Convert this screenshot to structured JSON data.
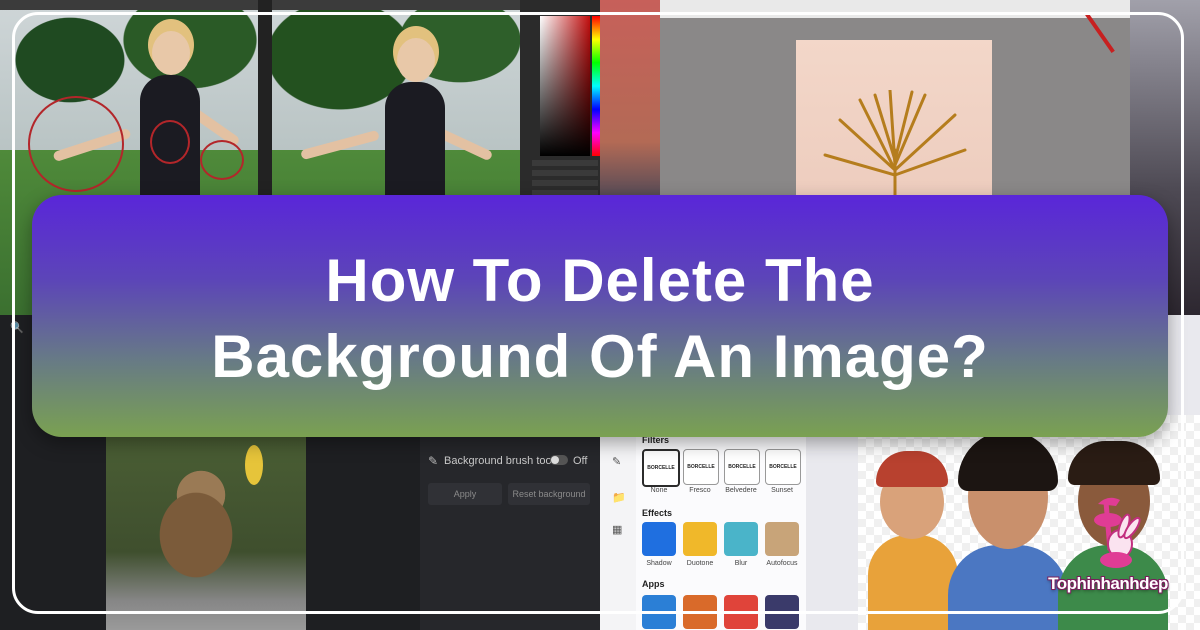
{
  "headline": {
    "line1": "How To Delete The",
    "line2": "Background Of An Image?"
  },
  "collage": {
    "bottom_left_app": {
      "toggle_label": "Background brush tool",
      "toggle_state": "Off",
      "apply_label": "Apply",
      "reset_label": "Reset background"
    },
    "bottom_right_app": {
      "filters_title": "Filters",
      "filters": [
        "None",
        "Fresco",
        "Belvedere",
        "Sunset"
      ],
      "filter_badge_text": "BORCELLE",
      "effects_title": "Effects",
      "effects": [
        "Shadow",
        "Duotone",
        "Blur",
        "Autofocus"
      ],
      "apps_title": "Apps"
    }
  },
  "logo": {
    "text": "Tophinhanhdep"
  },
  "colors": {
    "banner_top": "#5a26d9",
    "banner_bottom": "#7aa151",
    "headline_text": "#ffffff",
    "frame": "#ffffff"
  }
}
